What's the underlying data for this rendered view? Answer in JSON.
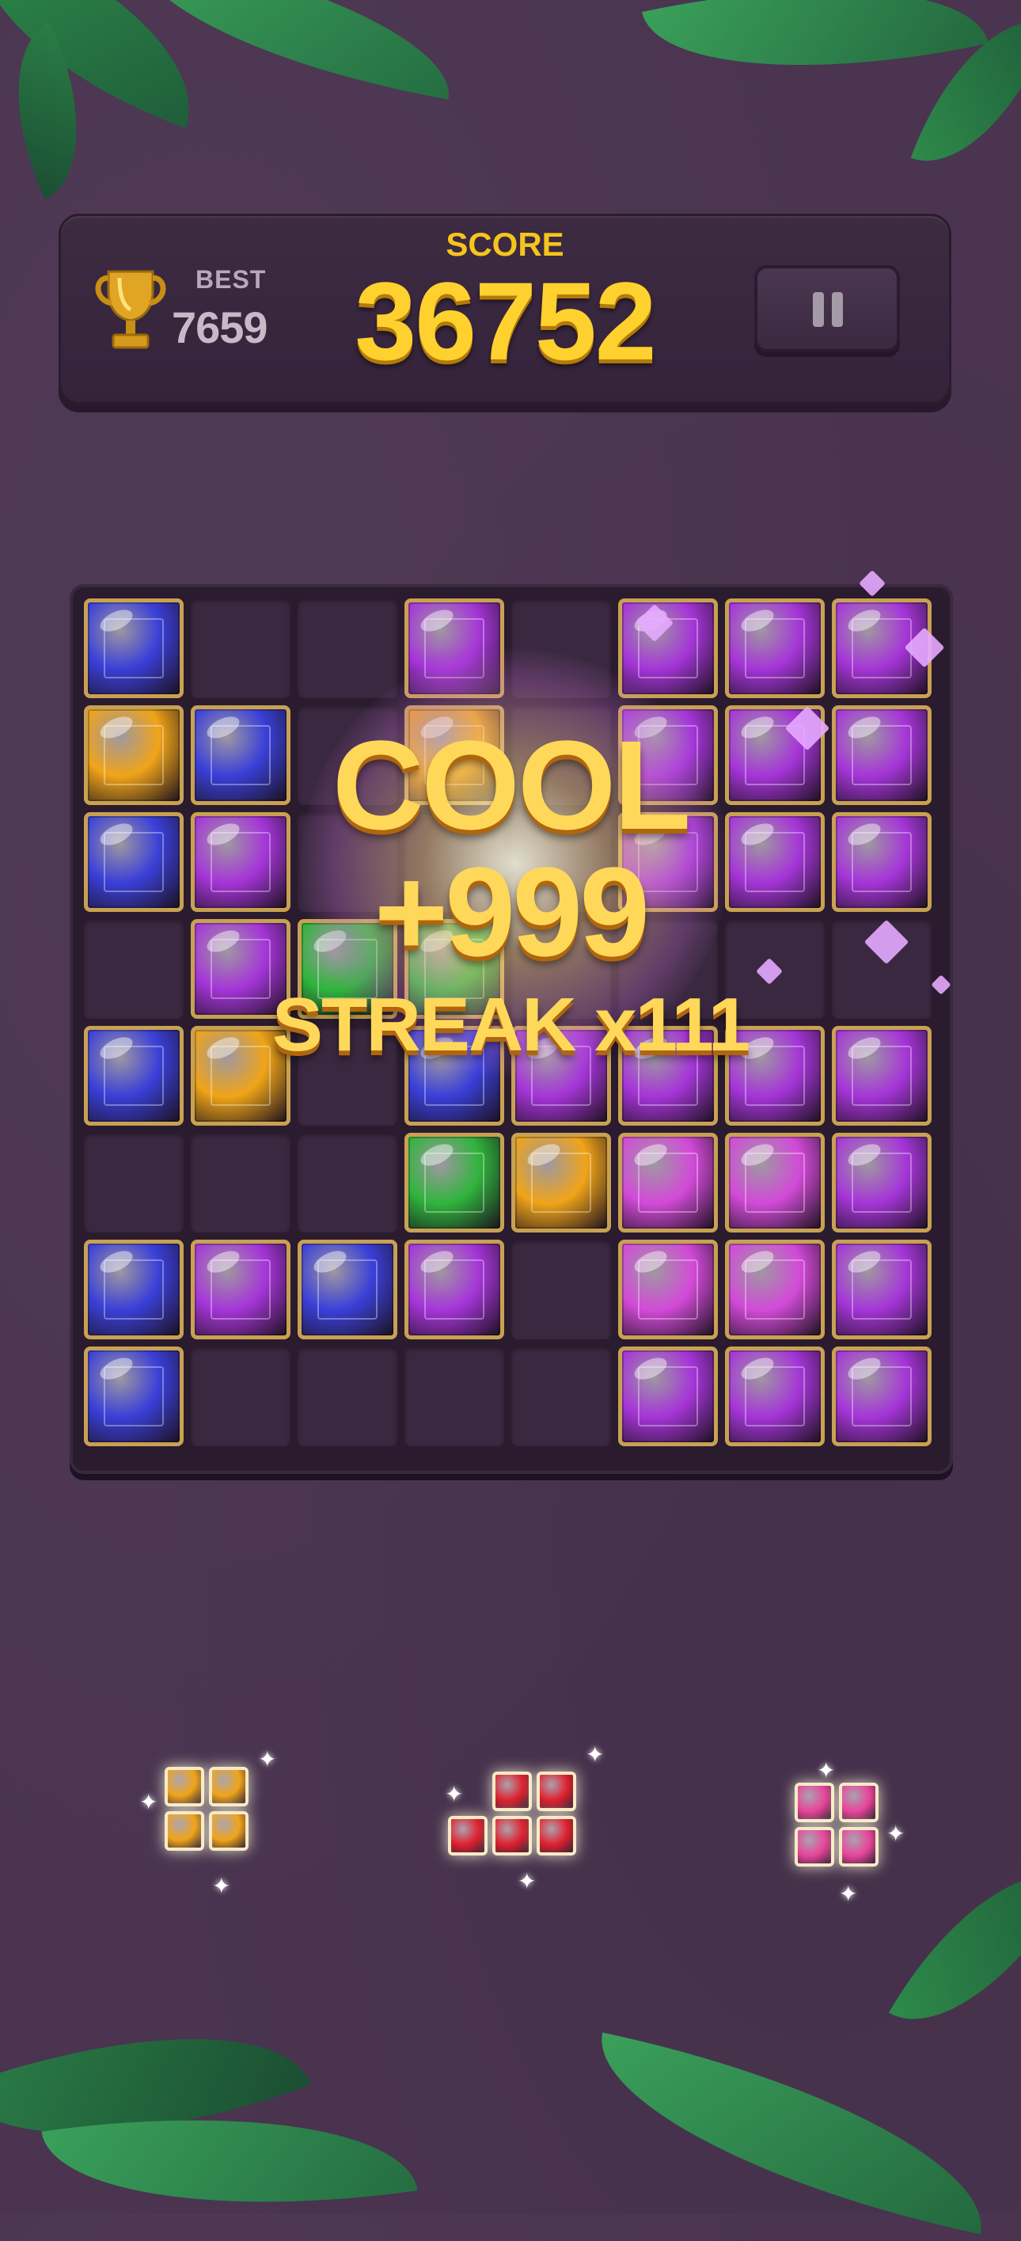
{
  "header": {
    "best_label": "BEST",
    "best_value": "7659",
    "score_label": "SCORE",
    "score_value": "36752"
  },
  "popup": {
    "rating": "COOL",
    "points": "+999",
    "streak": "STREAK x111"
  },
  "colors": {
    "blue": "#3a3fd8",
    "yellow": "#f0a418",
    "purple": "#a535d8",
    "green": "#2fb43c",
    "magenta": "#d24ad8",
    "red": "#e0202e",
    "pink": "#e8449a"
  },
  "board": {
    "rows": [
      [
        "blue",
        "empty",
        "empty",
        "purple",
        "empty",
        "purple",
        "purple",
        "purple"
      ],
      [
        "yellow",
        "blue",
        "empty",
        "yellow",
        "empty",
        "purple",
        "purple",
        "purple"
      ],
      [
        "blue",
        "purple",
        "empty",
        "empty",
        "empty",
        "purple",
        "purple",
        "purple"
      ],
      [
        "empty",
        "purple",
        "green",
        "green",
        "empty",
        "empty",
        "empty",
        "empty"
      ],
      [
        "blue",
        "yellow",
        "empty",
        "blue",
        "purple",
        "purple",
        "purple",
        "purple"
      ],
      [
        "empty",
        "empty",
        "empty",
        "green",
        "yellow",
        "magenta",
        "magenta",
        "purple"
      ],
      [
        "blue",
        "purple",
        "blue",
        "purple",
        "empty",
        "magenta",
        "magenta",
        "purple"
      ],
      [
        "blue",
        "empty",
        "empty",
        "empty",
        "empty",
        "purple",
        "purple",
        "purple"
      ]
    ]
  },
  "tray": [
    {
      "color": "yellow",
      "cells": [
        [
          0,
          0
        ],
        [
          1,
          0
        ],
        [
          0,
          1
        ],
        [
          1,
          1
        ]
      ]
    },
    {
      "color": "red",
      "cells": [
        [
          1,
          0
        ],
        [
          2,
          0
        ],
        [
          0,
          1
        ],
        [
          1,
          1
        ],
        [
          2,
          1
        ]
      ]
    },
    {
      "color": "pink",
      "cells": [
        [
          0,
          0
        ],
        [
          1,
          0
        ],
        [
          0,
          1
        ],
        [
          1,
          1
        ]
      ]
    }
  ]
}
